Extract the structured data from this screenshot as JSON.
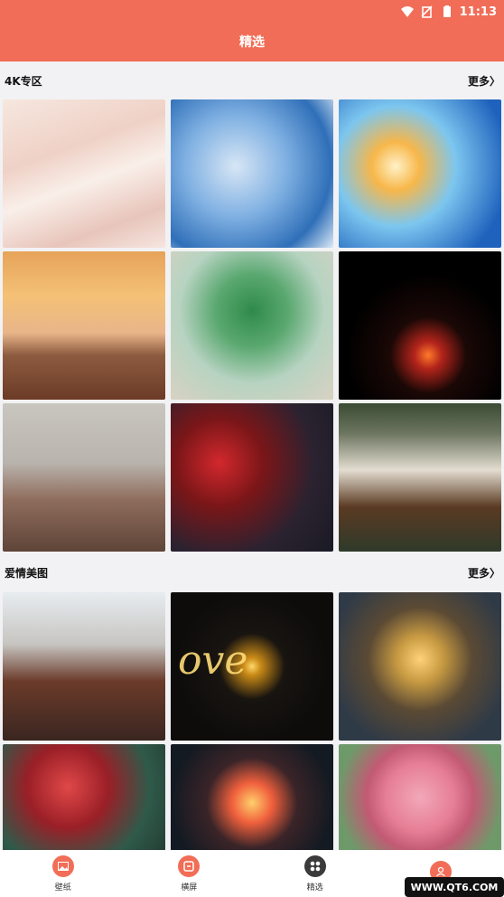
{
  "status": {
    "time": "11:13"
  },
  "header": {
    "title": "精选"
  },
  "sections": [
    {
      "title": "4K专区",
      "more": "更多",
      "more_chevron": "〉"
    },
    {
      "title": "爱情美图",
      "more": "更多",
      "more_chevron": "〉"
    }
  ],
  "tiles": {
    "section1": [
      "wallpaper-1",
      "wallpaper-2",
      "wallpaper-3",
      "wallpaper-4",
      "wallpaper-5",
      "wallpaper-6",
      "wallpaper-7",
      "wallpaper-8",
      "wallpaper-9"
    ],
    "section2": [
      "wallpaper-10",
      "wallpaper-11",
      "wallpaper-12",
      "wallpaper-13",
      "wallpaper-14",
      "wallpaper-15"
    ]
  },
  "overlay": {
    "love_text": "ove"
  },
  "bottom_nav": [
    {
      "label": "壁纸",
      "icon": "image-icon"
    },
    {
      "label": "横屏",
      "icon": "landscape-icon"
    },
    {
      "label": "精选",
      "icon": "featured-icon"
    },
    {
      "label": "",
      "icon": "profile-icon"
    }
  ],
  "watermark": {
    "text": "WWW.QT6.COM"
  },
  "colors": {
    "brand": "#f26d57",
    "nav_bg": "#ffffff",
    "page_bg": "#f2f2f4"
  }
}
